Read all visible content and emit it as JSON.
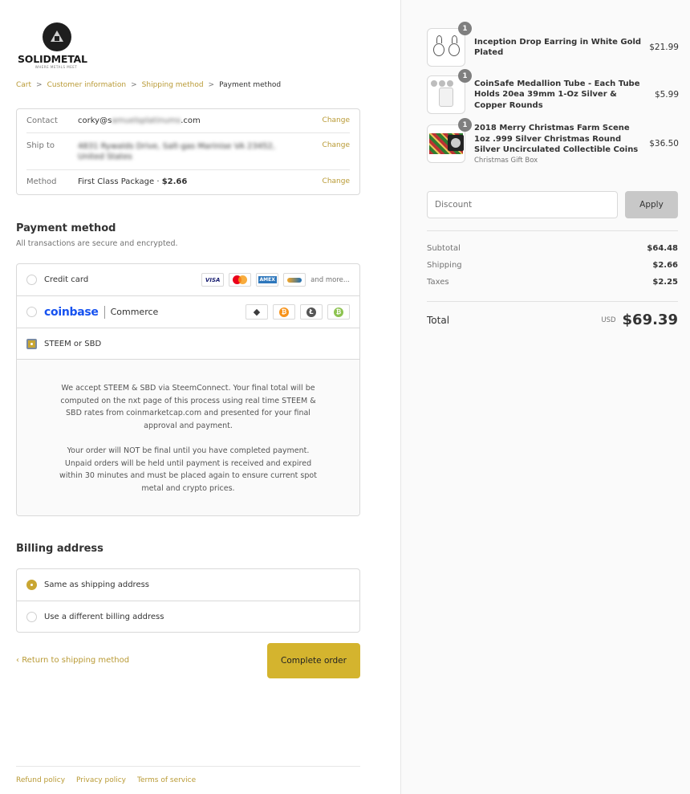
{
  "brand": {
    "name": "SOLIDMETAL",
    "tagline": "WHERE METALS MEET"
  },
  "breadcrumb": [
    {
      "label": "Cart"
    },
    {
      "label": "Customer information"
    },
    {
      "label": "Shipping method"
    },
    {
      "label": "Payment method"
    }
  ],
  "review": {
    "contact": {
      "label": "Contact",
      "value_prefix": "corky@s",
      "value_blurred": "amuelsplatinums",
      "value_suffix": ".com",
      "change": "Change"
    },
    "ship_to": {
      "label": "Ship to",
      "value_blurred": "4831 Rywalds Drive, Salt-gas Marinise VA 23452, United States",
      "change": "Change"
    },
    "method": {
      "label": "Method",
      "value": "First Class Package · ",
      "price": "$2.66",
      "change": "Change"
    }
  },
  "payment": {
    "title": "Payment method",
    "subtitle": "All transactions are secure and encrypted.",
    "options": {
      "credit_card": {
        "label": "Credit card",
        "visa": "VISA",
        "amex": "AMEX",
        "more": "and more..."
      },
      "coinbase": {
        "brand": "coinbase",
        "product": "Commerce"
      },
      "steem": {
        "label": "STEEM or SBD"
      }
    },
    "steem_info": [
      "We accept STEEM & SBD via SteemConnect. Your final total will be computed on the nxt page of this process using real time STEEM & SBD rates from coinmarketcap.com and presented for your final approval and payment.",
      "Your order will NOT be final until you have completed payment. Unpaid orders will be held until payment is received and expired within 30 minutes and must be placed again to ensure current spot metal and crypto prices."
    ]
  },
  "billing": {
    "title": "Billing address",
    "same": "Same as shipping address",
    "different": "Use a different billing address"
  },
  "actions": {
    "return": "Return to shipping method",
    "complete": "Complete order"
  },
  "footer": {
    "refund": "Refund policy",
    "privacy": "Privacy policy",
    "terms": "Terms of service"
  },
  "cart": {
    "items": [
      {
        "qty": "1",
        "name": "Inception Drop Earring in White Gold Plated",
        "variant": "",
        "price": "$21.99"
      },
      {
        "qty": "1",
        "name": "CoinSafe Medallion Tube - Each Tube Holds 20ea 39mm 1-Oz Silver & Copper Rounds",
        "variant": "",
        "price": "$5.99"
      },
      {
        "qty": "1",
        "name": "2018 Merry Christmas Farm Scene 1oz .999 Silver Christmas Round Silver Uncirculated Collectible Coins",
        "variant": "Christmas Gift Box",
        "price": "$36.50"
      }
    ],
    "discount_placeholder": "Discount",
    "apply": "Apply",
    "subtotal_label": "Subtotal",
    "subtotal": "$64.48",
    "shipping_label": "Shipping",
    "shipping": "$2.66",
    "taxes_label": "Taxes",
    "taxes": "$2.25",
    "total_label": "Total",
    "currency": "USD",
    "total": "$69.39"
  },
  "colors": {
    "accent": "#b99a35",
    "button": "#d4b42e",
    "coinbase_blue": "#1652f0"
  }
}
